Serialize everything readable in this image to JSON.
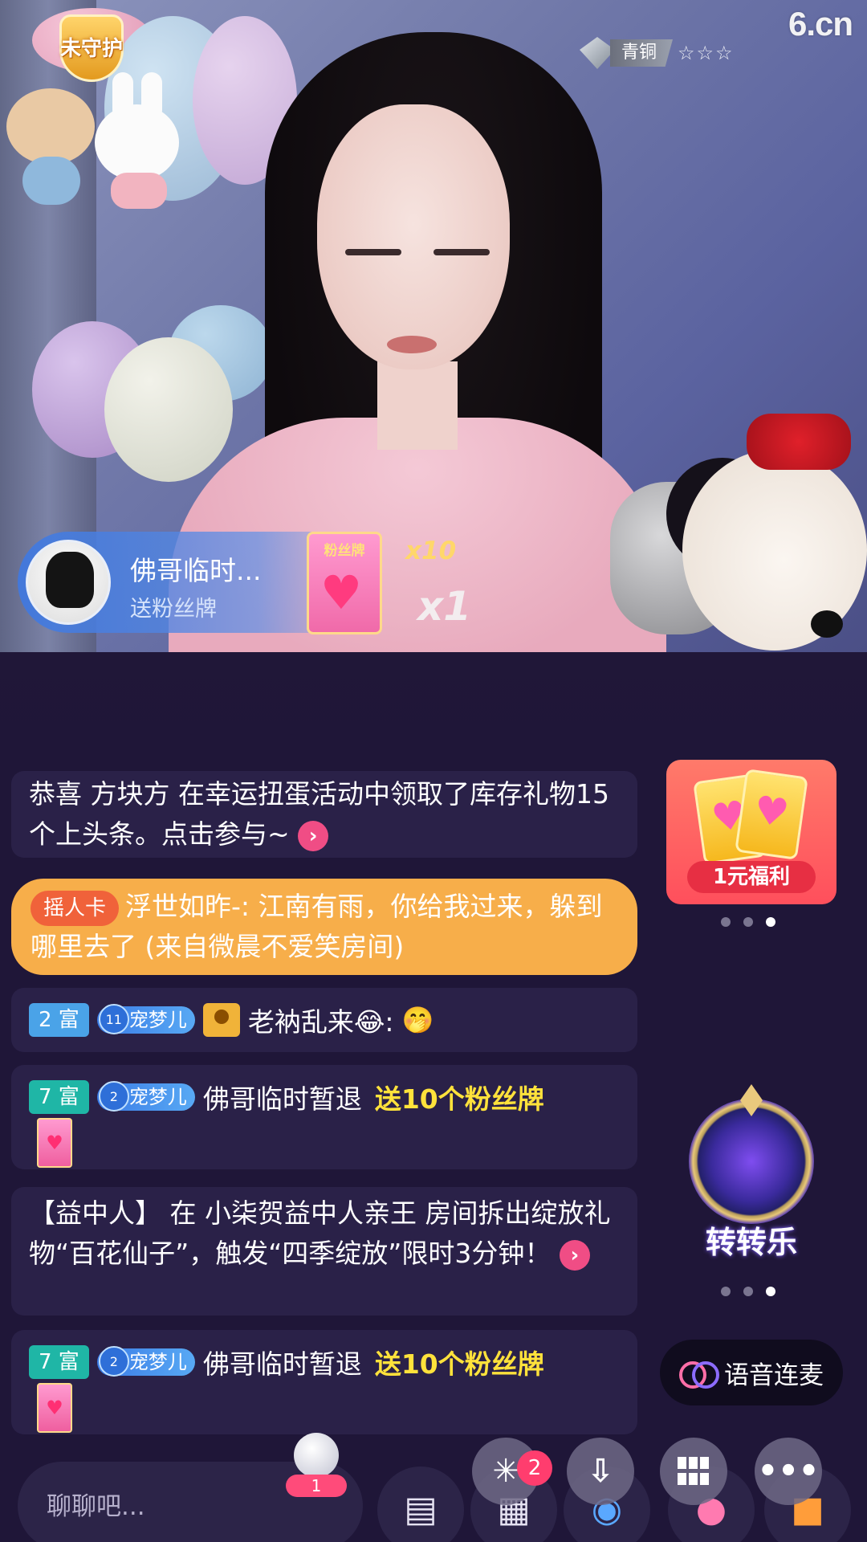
{
  "video": {
    "guard_badge": "未守护",
    "rank_label": "青铜",
    "rank_stars": "☆☆☆",
    "brand": "6.cn",
    "gift_notify": {
      "name": "佛哥临时...",
      "subtitle": "送粉丝牌",
      "card_label": "粉丝牌",
      "multiplier_top": "x10",
      "multiplier_big": "x1"
    }
  },
  "chat": {
    "msg1": {
      "text": "恭喜 方块方 在幸运扭蛋活动中领取了库存礼物15个上头条。点击参与~",
      "arrow": "›"
    },
    "msg2": {
      "tag": "摇人卡",
      "text": "浮世如昨-: 江南有雨，你给我过来，躲到哪里去了 (来自微晨不爱笑房间)"
    },
    "msg3": {
      "rich": "2 富",
      "fan_level": "11",
      "fan_name": "宠梦儿",
      "user": "老衲乱来😂:",
      "emoji": "🤭"
    },
    "msg4": {
      "rich": "7 富",
      "fan_level": "2",
      "fan_name": "宠梦儿",
      "user": "佛哥临时暂退",
      "gift": "送10个粉丝牌"
    },
    "msg5": {
      "text": "【益中人】 在 小柒贺益中人亲王 房间拆出绽放礼物“百花仙子”，触发“四季绽放”限时3分钟！",
      "arrow": "›"
    },
    "msg6": {
      "rich": "7 富",
      "fan_level": "2",
      "fan_name": "宠梦儿",
      "user": "佛哥临时暂退",
      "gift": "送10个粉丝牌"
    }
  },
  "widgets": {
    "promo_label": "1元福利",
    "wheel_label": "转转乐",
    "voice_button": "语音连麦"
  },
  "bottom_bar": {
    "chat_placeholder": "聊聊吧...",
    "like_count": "1",
    "float_badge": "2"
  },
  "colors": {
    "background": "#1f1638",
    "chat_bubble": "#2a2148",
    "highlight_bubble": "#f7ae4a",
    "gift_text": "#ffe23b",
    "accent_pink": "#f04d85"
  },
  "icons": [
    "shield-icon",
    "diamond-icon",
    "star-icon",
    "heart-icon",
    "arrow-right-icon",
    "chat-icon",
    "grid-icon",
    "gamepad-icon",
    "gift-box-icon",
    "download-icon",
    "more-icon",
    "link-icon",
    "share-icon"
  ]
}
